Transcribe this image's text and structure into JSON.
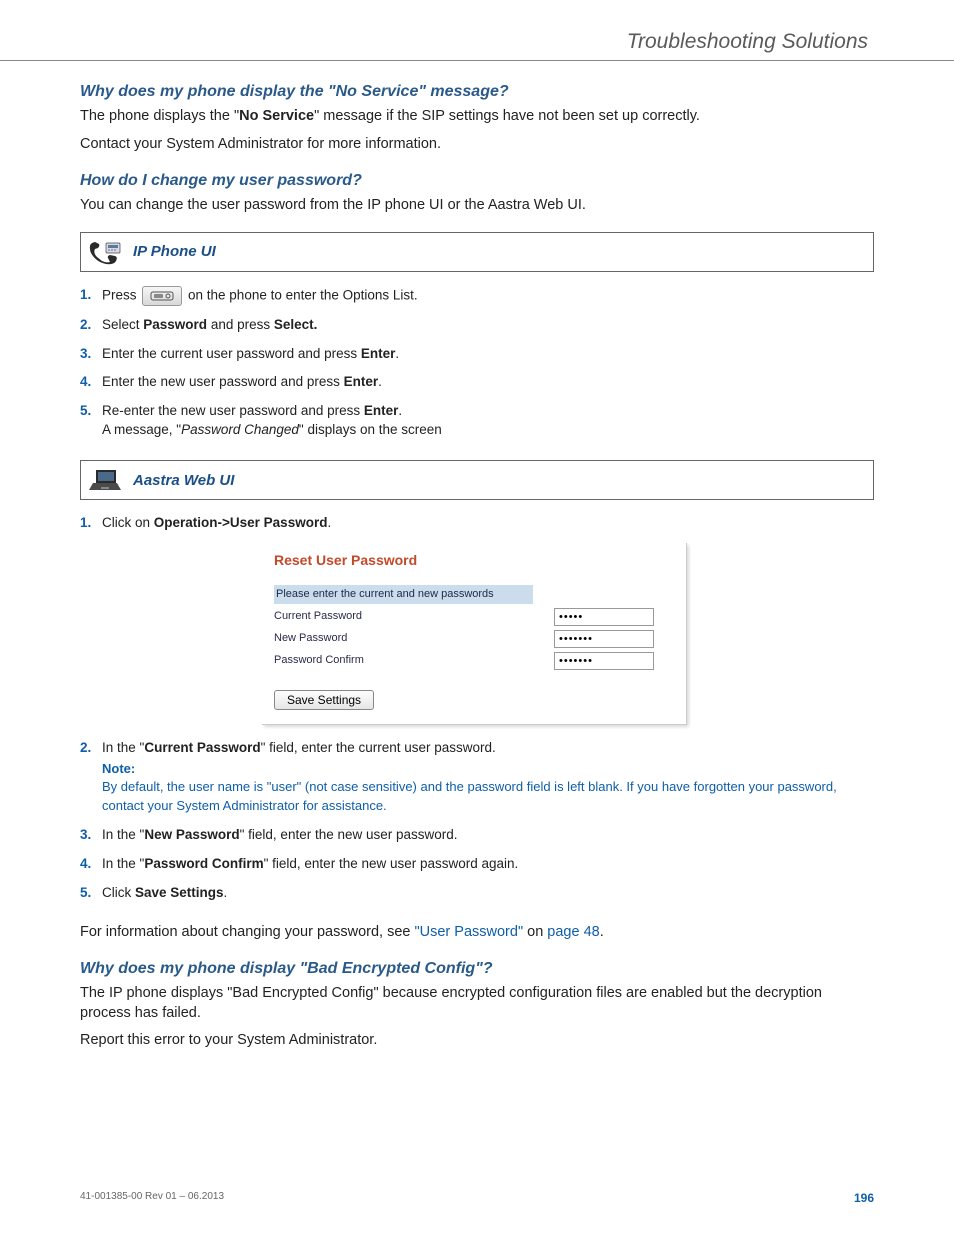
{
  "header": {
    "section_title": "Troubleshooting Solutions"
  },
  "q1": {
    "heading": "Why does my phone display the \"No Service\" message?",
    "p1a": "The phone displays the \"",
    "p1b": "No Service",
    "p1c": "\" message if the SIP settings have not been set up correctly.",
    "p2": "Contact your System Administrator for more information."
  },
  "q2": {
    "heading": "How do I change my user password?",
    "p1": "You can change the user password from the IP phone UI or the Aastra Web UI."
  },
  "ip_ui": {
    "label": "IP Phone UI",
    "steps": {
      "s1a": "Press ",
      "s1b": " on the phone to enter the Options List.",
      "s2a": "Select ",
      "s2b": "Password",
      "s2c": " and press ",
      "s2d": "Select.",
      "s3a": "Enter the current user password and press ",
      "s3b": "Enter",
      "s3c": ".",
      "s4a": "Enter the new user password and press ",
      "s4b": "Enter",
      "s4c": ".",
      "s5a": "Re-enter the new user password and press ",
      "s5b": "Enter",
      "s5c": ".",
      "s5d": "A message, \"",
      "s5e": "Password Changed",
      "s5f": "\" displays on the screen"
    }
  },
  "web_ui": {
    "label": "Aastra Web UI",
    "step1a": "Click on ",
    "step1b": "Operation->User Password",
    "step1c": "."
  },
  "reset": {
    "title": "Reset User Password",
    "instr": "Please enter the current and new passwords",
    "cur_lbl": "Current Password",
    "new_lbl": "New Password",
    "conf_lbl": "Password Confirm",
    "cur_val": "•••••",
    "new_val": "•••••••",
    "conf_val": "•••••••",
    "save": "Save Settings"
  },
  "web_steps": {
    "s2a": "In the \"",
    "s2b": "Current Password",
    "s2c": "\" field, enter the current user password.",
    "note_label": "Note:",
    "note_text": "By default, the user name is \"user\" (not case sensitive) and the password field is left blank. If you have forgotten your password, contact your System Administrator for assistance.",
    "s3a": "In the \"",
    "s3b": "New Password",
    "s3c": "\" field, enter the new user password.",
    "s4a": "In the \"",
    "s4b": "Password Confirm",
    "s4c": "\" field, enter the new user password again.",
    "s5a": "Click ",
    "s5b": "Save Settings",
    "s5c": "."
  },
  "xref": {
    "a": "For information about changing your password, see ",
    "link1": "\"User Password\"",
    "b": " on ",
    "link2": "page 48",
    "c": "."
  },
  "q3": {
    "heading": "Why does my phone display \"Bad Encrypted Config\"?",
    "p1": "The IP phone displays \"Bad Encrypted Config\" because encrypted configuration files are enabled but the decryption process has failed.",
    "p2": "Report this error to your System Administrator."
  },
  "footer": {
    "rev": "41-001385-00 Rev 01 – 06.2013",
    "page": "196"
  }
}
